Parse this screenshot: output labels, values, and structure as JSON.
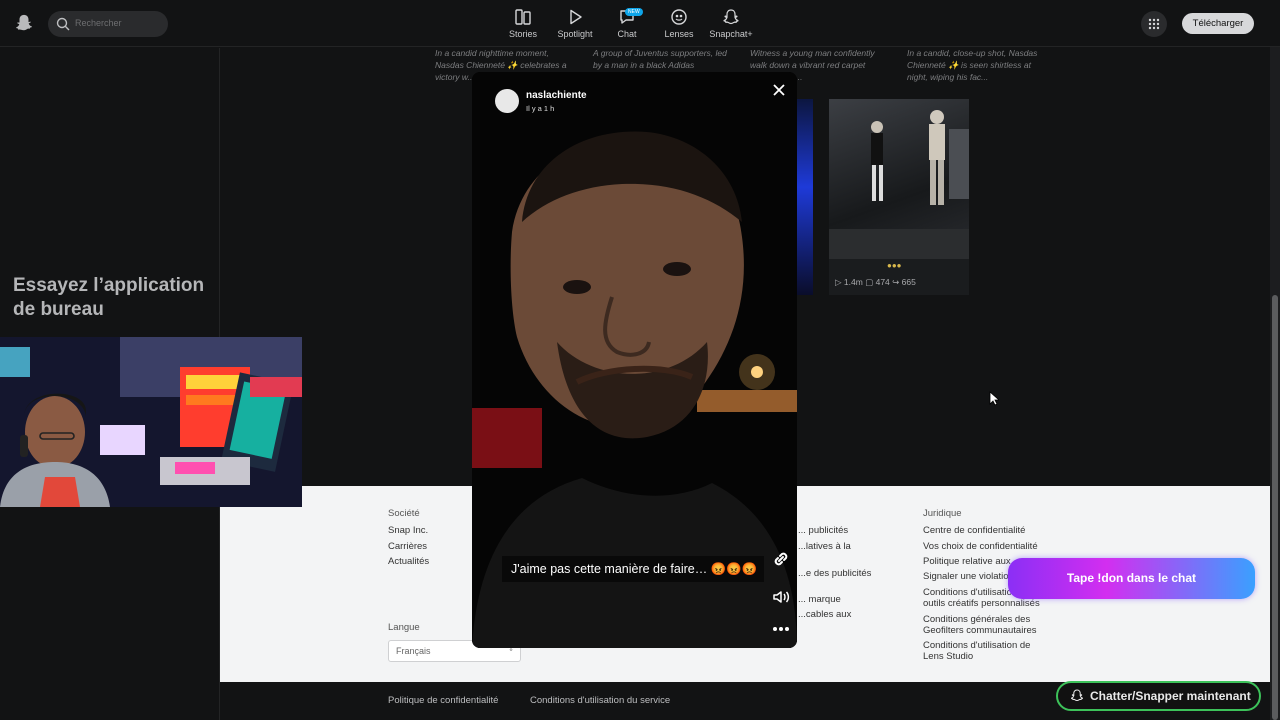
{
  "header": {
    "search_placeholder": "Rechercher",
    "nav": [
      {
        "label": "Stories",
        "icon": "stories-icon"
      },
      {
        "label": "Spotlight",
        "icon": "play-icon"
      },
      {
        "label": "Chat",
        "icon": "chat-icon",
        "badge": "NEW"
      },
      {
        "label": "Lenses",
        "icon": "lens-icon"
      },
      {
        "label": "Snapchat+",
        "icon": "ghost-plus-icon"
      }
    ],
    "download_label": "Télécharger"
  },
  "sidebar": {
    "promo": "Essayez l’application de bureau"
  },
  "captions": [
    "In a candid nighttime moment, Nasdas Chienneté ✨ celebrates a victory w...",
    "A group of Juventus supporters, led by a man in a black Adidas",
    "Witness a young man confidently walk down a vibrant red carpet ...ting lights....",
    "In a candid, close-up shot, Nasdas Chienneté ✨ is seen shirtless at night, wiping his fac..."
  ],
  "spotlight_card": {
    "dots": "●●●",
    "views": "1.4m",
    "comments": "474",
    "shares": "665"
  },
  "story": {
    "username": "naslachiente",
    "time": "Il y a 1 h",
    "caption": "J'aime pas cette manière de faire… 😡😡😡"
  },
  "footer": {
    "company_head": "Société",
    "company_links": [
      "Snap Inc.",
      "Carrières",
      "Actualités"
    ],
    "ads_links": [
      "... publicités",
      "...latives à la",
      "...e des publicités",
      "... marque",
      "...cables aux"
    ],
    "legal_head": "Juridique",
    "legal_links": [
      "Centre de confidentialité",
      "Vos choix de confidentialité",
      "Politique relative aux...",
      "Signaler une violatio...",
      "Conditions d'utilisation des outils créatifs personnalisés",
      "Conditions générales des Geofilters communautaires",
      "Conditions d'utilisation de Lens Studio"
    ],
    "language_head": "Langue",
    "language_value": "Français",
    "bottom_links": [
      "Politique de confidentialité",
      "Conditions d'utilisation du service"
    ]
  },
  "overlay": {
    "cta": "Tape !don dans le chat",
    "chat_now": "Chatter/Snapper maintenant"
  },
  "colors": {
    "accent_green": "#3dc25a",
    "cta_purple": "#8b2ff5",
    "cta_blue": "#3aa0ff"
  }
}
